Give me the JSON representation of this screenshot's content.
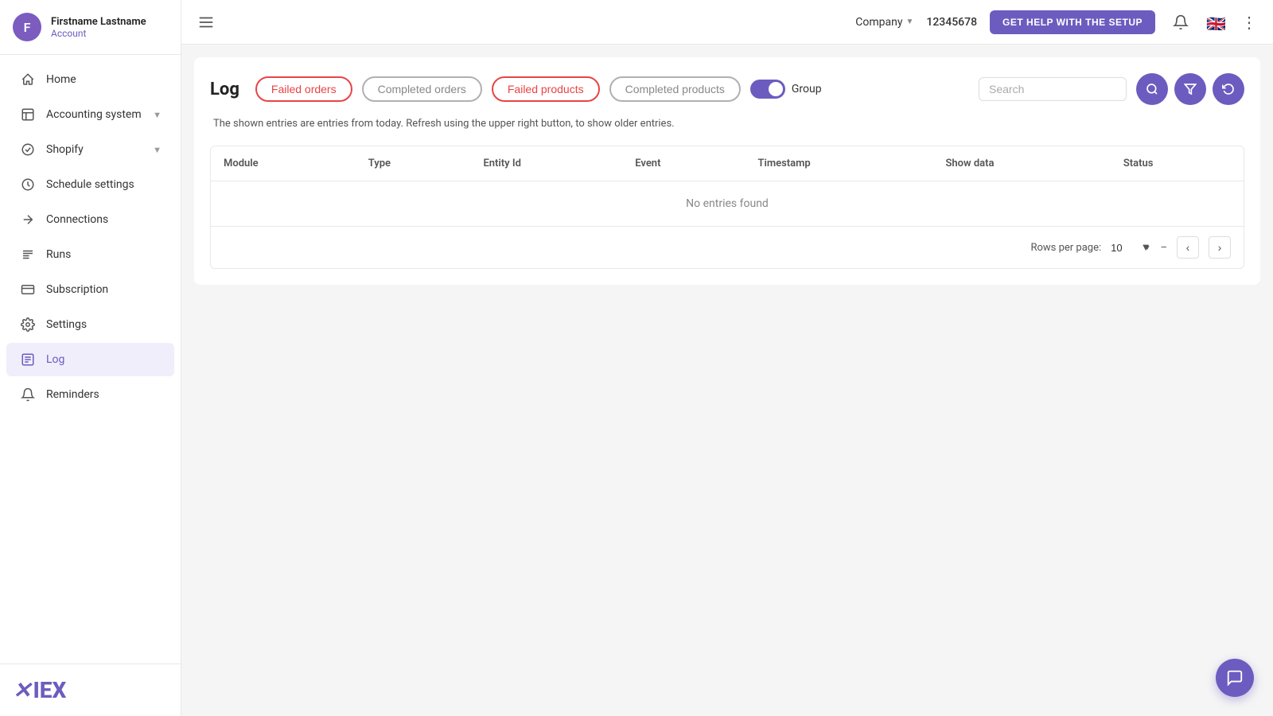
{
  "sidebar": {
    "user": {
      "initials": "F",
      "name": "Firstname Lastname",
      "account_label": "Account"
    },
    "nav_items": [
      {
        "id": "home",
        "label": "Home",
        "icon": "home"
      },
      {
        "id": "accounting-system",
        "label": "Accounting system",
        "icon": "accounting",
        "has_chevron": true
      },
      {
        "id": "shopify",
        "label": "Shopify",
        "icon": "shopify",
        "has_chevron": true
      },
      {
        "id": "schedule-settings",
        "label": "Schedule settings",
        "icon": "schedule"
      },
      {
        "id": "connections",
        "label": "Connections",
        "icon": "connections"
      },
      {
        "id": "runs",
        "label": "Runs",
        "icon": "runs"
      },
      {
        "id": "subscription",
        "label": "Subscription",
        "icon": "subscription"
      },
      {
        "id": "settings",
        "label": "Settings",
        "icon": "settings"
      },
      {
        "id": "log",
        "label": "Log",
        "icon": "log",
        "active": true
      },
      {
        "id": "reminders",
        "label": "Reminders",
        "icon": "reminders"
      }
    ],
    "logo": "✕IEX"
  },
  "topbar": {
    "company_label": "Company",
    "company_id": "12345678",
    "help_btn_label": "GET HELP WITH THE SETUP"
  },
  "log_page": {
    "title": "Log",
    "filters": [
      {
        "id": "failed-orders",
        "label": "Failed orders",
        "style": "active-red"
      },
      {
        "id": "completed-orders",
        "label": "Completed orders",
        "style": "inactive"
      },
      {
        "id": "failed-products",
        "label": "Failed products",
        "style": "active-red"
      },
      {
        "id": "completed-products",
        "label": "Completed products",
        "style": "inactive"
      }
    ],
    "group_toggle": {
      "label": "Group",
      "checked": true
    },
    "search_placeholder": "Search",
    "info_text": "The shown entries are entries from today. Refresh using the upper right button, to show older entries.",
    "table": {
      "columns": [
        "Module",
        "Type",
        "Entity Id",
        "Event",
        "Timestamp",
        "Show data",
        "Status"
      ],
      "empty_message": "No entries found"
    },
    "pagination": {
      "rows_per_page_label": "Rows per page:",
      "rows_per_page_value": "10",
      "page_info": "–"
    }
  }
}
